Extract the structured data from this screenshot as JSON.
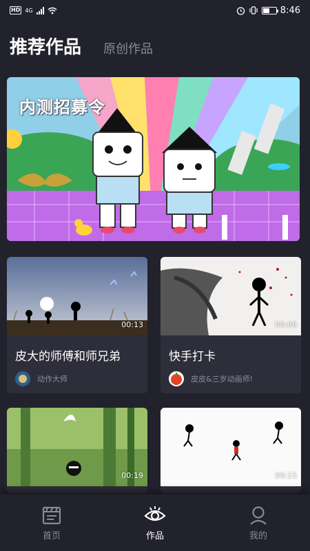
{
  "status_bar": {
    "left_badge": "HD",
    "network": "4G",
    "time": "8:46"
  },
  "header": {
    "active_tab": "推荐作品",
    "inactive_tab": "原创作品"
  },
  "banner": {
    "title": "内测招募令"
  },
  "cards": [
    {
      "title": "皮大的师傅和师兄弟",
      "author": "动作大师",
      "duration": "00:13"
    },
    {
      "title": "快手打卡",
      "author": "皮皮&三岁动画师!",
      "duration": "00:06"
    },
    {
      "duration": "00:19"
    },
    {
      "duration": "00:15"
    }
  ],
  "nav": [
    {
      "label": "首页",
      "icon": "film-icon",
      "active": false
    },
    {
      "label": "作品",
      "icon": "eye-icon",
      "active": true
    },
    {
      "label": "我的",
      "icon": "user-icon",
      "active": false
    }
  ],
  "colors": {
    "background": "#22222d",
    "card": "#2e2e3a",
    "inactive_text": "#8b8b96"
  }
}
